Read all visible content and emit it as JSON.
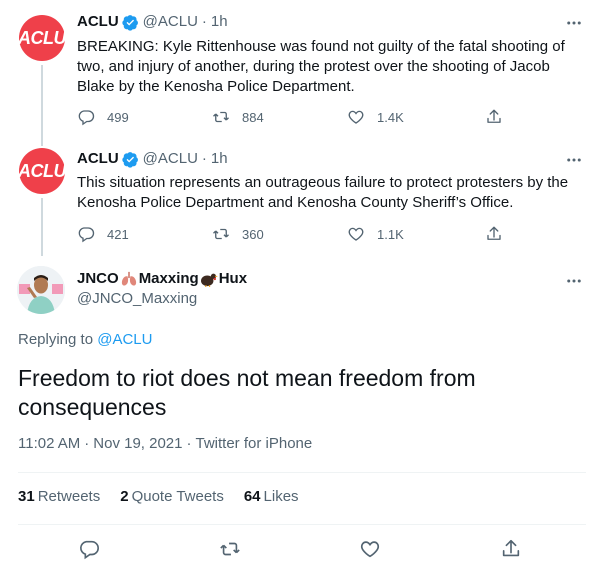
{
  "tweets": [
    {
      "avatar_text": "ACLU",
      "name": "ACLU",
      "handle": "@ACLU",
      "time": "1h",
      "text": "BREAKING: Kyle Rittenhouse was found not guilty of the fatal shooting of two, and injury of another, during the protest over the shooting of Jacob Blake by the Kenosha Police Department.",
      "replies": "499",
      "retweets": "884",
      "likes": "1.4K"
    },
    {
      "avatar_text": "ACLU",
      "name": "ACLU",
      "handle": "@ACLU",
      "time": "1h",
      "text": "This situation represents an outrageous failure to protect protesters by the Kenosha Police Department and Kenosha County Sheriff’s Office.",
      "replies": "421",
      "retweets": "360",
      "likes": "1.1K"
    }
  ],
  "main": {
    "name_part1": "JNCO",
    "name_part2": "Maxxing",
    "name_part3": "Hux",
    "handle": "@JNCO_Maxxing",
    "replying_prefix": "Replying to",
    "replying_to": "@ACLU",
    "text": "Freedom to riot does not mean freedom from consequences",
    "time": "11:02 AM",
    "date": "Nov 19, 2021",
    "source": "Twitter for iPhone",
    "retweets": "31",
    "retweets_label": "Retweets",
    "quotes": "2",
    "quotes_label": "Quote Tweets",
    "likes": "64",
    "likes_label": "Likes"
  },
  "icons": [
    "verified-badge-icon",
    "more-icon",
    "reply-icon",
    "retweet-icon",
    "like-icon",
    "share-icon",
    "lungs-emoji-icon",
    "turkey-emoji-icon"
  ],
  "colors": {
    "aclu_red": "#ef404a",
    "link_blue": "#1d9bf0",
    "muted": "#536471"
  }
}
